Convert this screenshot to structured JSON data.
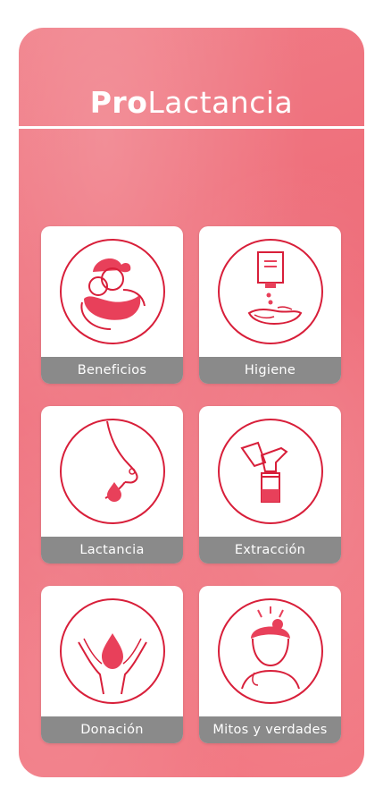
{
  "app": {
    "title_bold": "Pro",
    "title_regular": "Lactancia",
    "accent_color": "#ee6a77",
    "label_bar_color": "#8a8a8a"
  },
  "menu": {
    "items": [
      {
        "label": "Beneficios",
        "icon": "mother-baby-icon"
      },
      {
        "label": "Higiene",
        "icon": "soap-dispenser-hands-icon"
      },
      {
        "label": "Lactancia",
        "icon": "breast-milk-drop-icon"
      },
      {
        "label": "Extracción",
        "icon": "breast-pump-icon"
      },
      {
        "label": "Donación",
        "icon": "hands-milk-drop-icon"
      },
      {
        "label": "Mitos y verdades",
        "icon": "thinking-woman-icon"
      }
    ]
  }
}
